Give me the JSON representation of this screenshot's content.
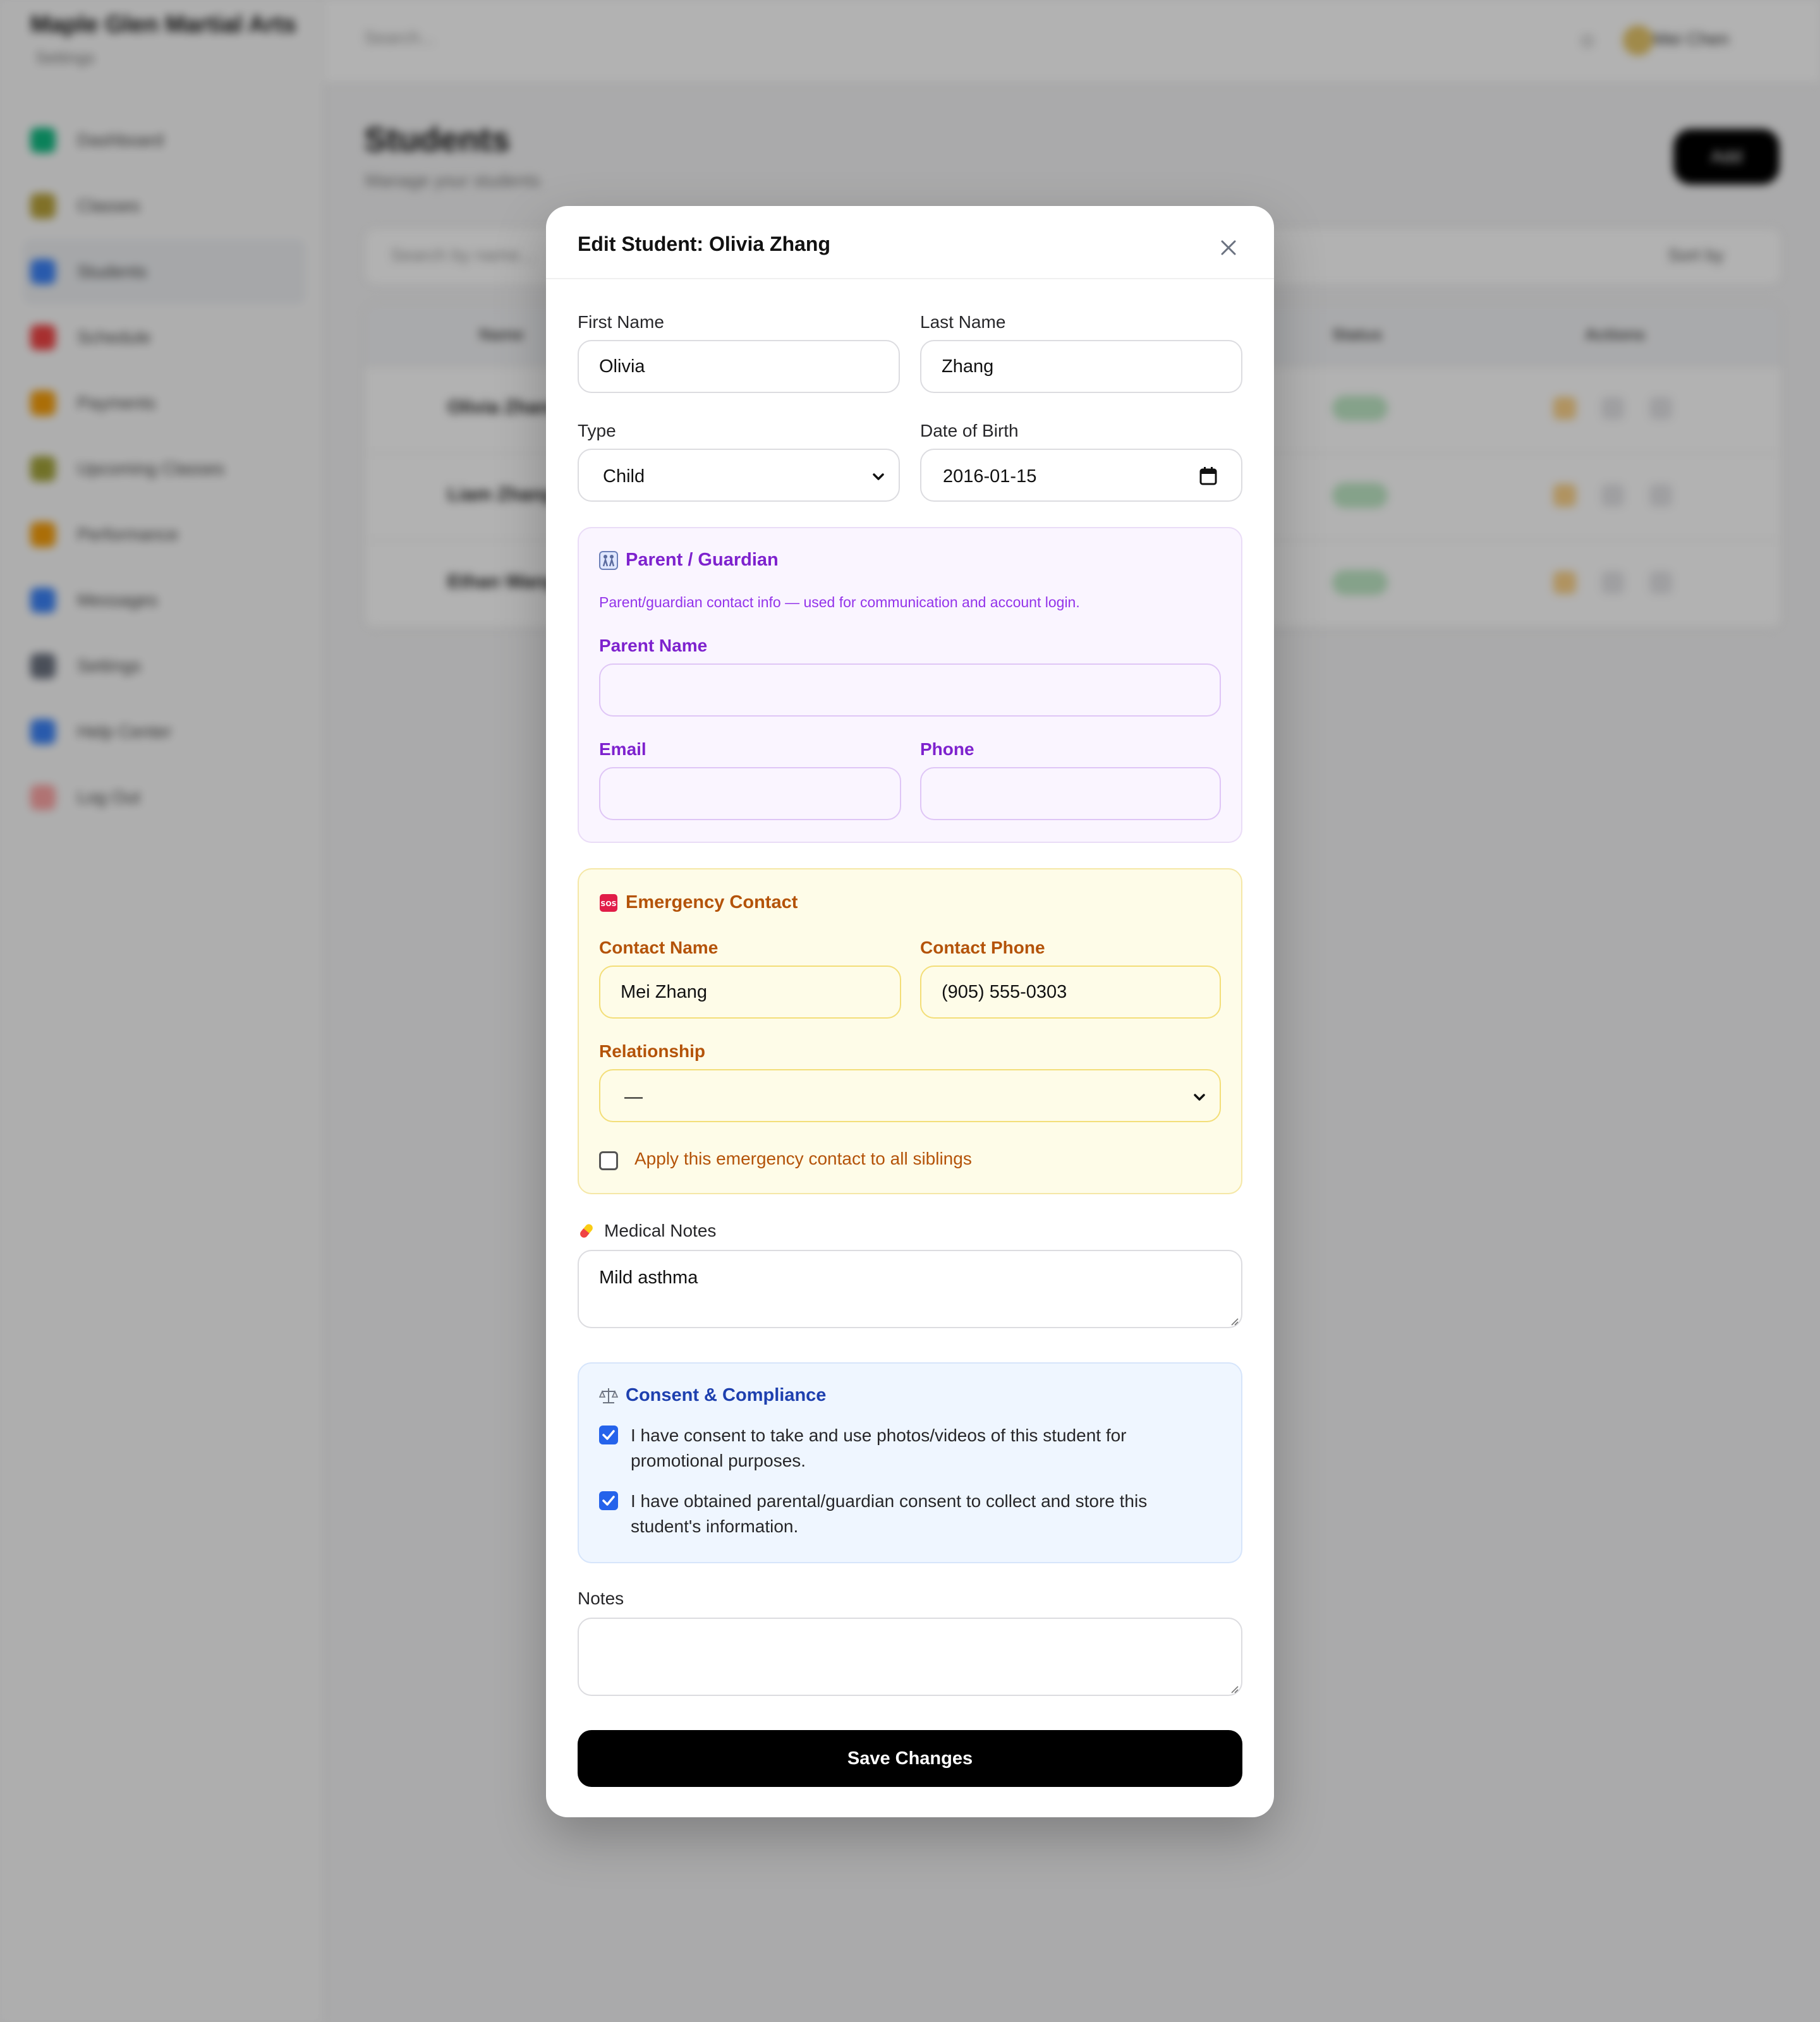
{
  "background_app": {
    "brand": {
      "title": "Maple Glen Martial Arts",
      "subtitle": "Settings"
    },
    "nav": [
      {
        "label": "Dashboard",
        "color": "#10b981"
      },
      {
        "label": "Classes",
        "color": "#b8a23a"
      },
      {
        "label": "Students",
        "color": "#3b82f6"
      },
      {
        "label": "Schedule",
        "color": "#ef4444"
      },
      {
        "label": "Payments",
        "color": "#f59e0b"
      },
      {
        "label": "Upcoming Classes",
        "color": "#a3a33a"
      },
      {
        "label": "Performance",
        "color": "#f59e0b"
      },
      {
        "label": "Messages",
        "color": "#3b82f6"
      },
      {
        "label": "Settings",
        "color": "#6b7280"
      },
      {
        "label": "Help Center",
        "color": "#3b82f6"
      },
      {
        "label": "Log Out",
        "color": "#ef4444"
      }
    ],
    "topbar": {
      "search": "Search...",
      "user": "Mei Chen"
    },
    "page": {
      "title": "Students",
      "subtitle": "Manage your students",
      "add_button": "Add"
    },
    "filter": {
      "search": "Search by name...",
      "sort": "Sort by"
    },
    "table": {
      "headers": [
        "Name",
        "Status",
        "Actions"
      ],
      "rows": [
        {
          "name": "Olivia Zhang"
        },
        {
          "name": "Liam Zhang"
        },
        {
          "name": "Ethan Wang"
        }
      ]
    }
  },
  "modal": {
    "title": "Edit Student: Olivia Zhang",
    "first_name": {
      "label": "First Name",
      "value": "Olivia"
    },
    "last_name": {
      "label": "Last Name",
      "value": "Zhang"
    },
    "type": {
      "label": "Type",
      "value": "Child"
    },
    "dob": {
      "label": "Date of Birth",
      "value": "2016-01-15"
    },
    "parent": {
      "title": "Parent / Guardian",
      "icon": "family-icon",
      "description": "Parent/guardian contact info — used for communication and account login.",
      "name_label": "Parent Name",
      "name_value": "",
      "email_label": "Email",
      "email_value": "",
      "phone_label": "Phone",
      "phone_value": "",
      "color": "#7e22ce"
    },
    "emergency": {
      "title": "Emergency Contact",
      "icon": "sos-icon",
      "contact_name_label": "Contact Name",
      "contact_name_value": "Mei Zhang",
      "contact_phone_label": "Contact Phone",
      "contact_phone_value": "(905) 555-0303",
      "relationship_label": "Relationship",
      "relationship_value": "—",
      "apply_siblings_label": "Apply this emergency contact to all siblings",
      "apply_siblings_checked": false,
      "color": "#b45309"
    },
    "medical": {
      "label": "Medical Notes",
      "icon": "pill-icon",
      "value": "Mild asthma"
    },
    "consent": {
      "title": "Consent & Compliance",
      "icon": "scales-icon",
      "photo_label": "I have consent to take and use photos/videos of this student for promotional purposes.",
      "photo_checked": true,
      "data_label": "I have obtained parental/guardian consent to collect and store this student's information.",
      "data_checked": true,
      "color": "#1e40af"
    },
    "notes": {
      "label": "Notes",
      "value": ""
    },
    "save_button": "Save Changes"
  }
}
